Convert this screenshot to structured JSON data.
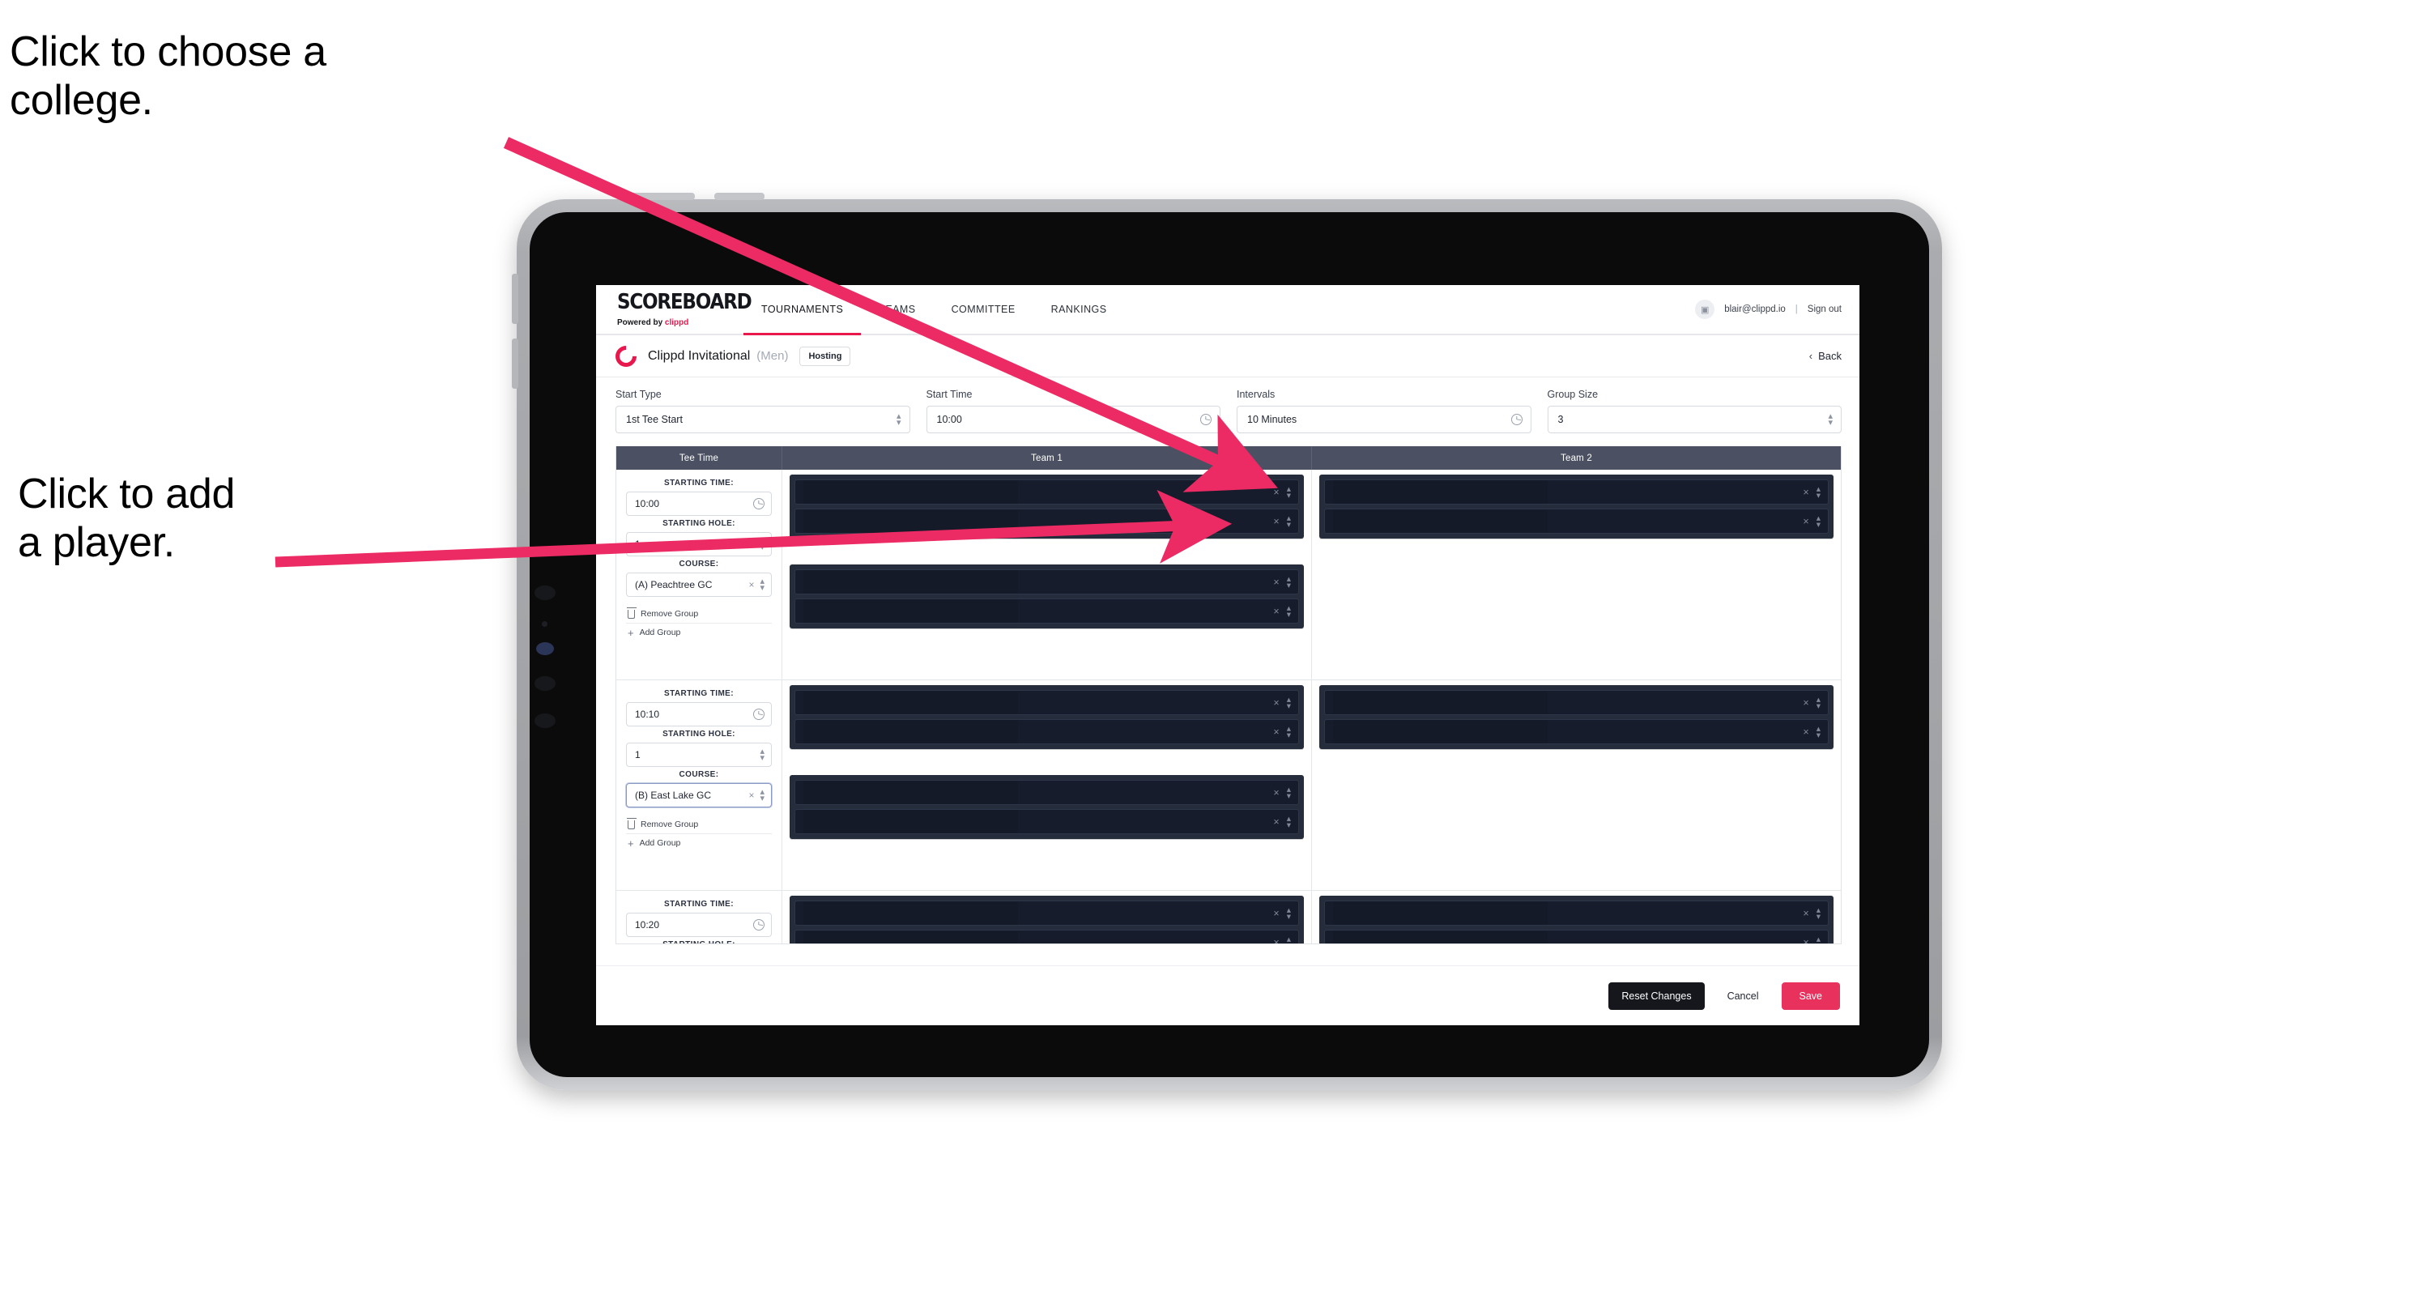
{
  "annotations": {
    "college": "Click to choose a\ncollege.",
    "player": "Click to add\na player."
  },
  "colors": {
    "accent": "#e8174c",
    "save": "#e8315c",
    "header_bar": "#4b5162",
    "panel_dark": "#252c3b",
    "slot_dark": "#161c2b"
  },
  "topnav": {
    "brand_title": "SCOREBOARD",
    "brand_sub_prefix": "Powered by ",
    "brand_sub_keyword": "clippd",
    "tabs": [
      {
        "label": "TOURNAMENTS",
        "active": true
      },
      {
        "label": "TEAMS",
        "active": false
      },
      {
        "label": "COMMITTEE",
        "active": false
      },
      {
        "label": "RANKINGS",
        "active": false
      }
    ],
    "avatar_glyph": "▣",
    "user_email": "blair@clippd.io",
    "separator": "|",
    "sign_out": "Sign out"
  },
  "tournament": {
    "name": "Clippd Invitational",
    "gender": "(Men)",
    "badge": "Hosting",
    "back_chevron": "‹",
    "back_label": "Back"
  },
  "controls": [
    {
      "label": "Start Type",
      "value": "1st Tee Start",
      "icon": "stepper-icon"
    },
    {
      "label": "Start Time",
      "value": "10:00",
      "icon": "clock-icon"
    },
    {
      "label": "Intervals",
      "value": "10 Minutes",
      "icon": "clock-icon"
    },
    {
      "label": "Group Size",
      "value": "3",
      "icon": "stepper-icon"
    }
  ],
  "schedule": {
    "headers": {
      "tee": "Tee Time",
      "team1": "Team 1",
      "team2": "Team 2"
    },
    "field_labels": {
      "starting_time": "STARTING TIME:",
      "starting_hole": "STARTING HOLE:",
      "course": "COURSE:"
    },
    "group_actions": {
      "remove": "Remove Group",
      "add": "Add Group"
    },
    "rows": [
      {
        "starting_time": "10:00",
        "starting_hole": "1",
        "course": "(A) Peachtree GC",
        "course_focused": false,
        "team1_panels": 2,
        "team2_panels": 1,
        "slots_per_panel": 2
      },
      {
        "starting_time": "10:10",
        "starting_hole": "1",
        "course": "(B) East Lake GC",
        "course_focused": true,
        "team1_panels": 2,
        "team2_panels": 1,
        "slots_per_panel": 2
      },
      {
        "starting_time": "10:20",
        "starting_hole": "",
        "course": "",
        "course_focused": false,
        "team1_panels": 1,
        "team2_panels": 1,
        "slots_per_panel": 2
      }
    ],
    "slot_icons": {
      "clear": "×",
      "stepper": "stepper-icon"
    }
  },
  "footer": {
    "reset": "Reset Changes",
    "cancel": "Cancel",
    "save": "Save"
  }
}
